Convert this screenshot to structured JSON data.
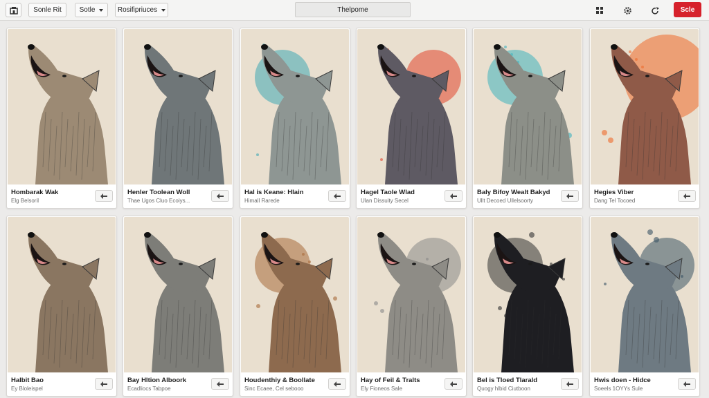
{
  "toolbar": {
    "home_icon": "home-icon",
    "title": "Sonle Rit",
    "sort_label": "Sotle",
    "filter_label": "Rosifipriuces",
    "search_placeholder": "Thelpome",
    "action_label": "Scle"
  },
  "cards": [
    {
      "title": "Hombarak Wak",
      "subtitle": "Elg Belsoril",
      "fur": "#9c8a74",
      "splash": ""
    },
    {
      "title": "Henler Toolean Woll",
      "subtitle": "Thae Ugos Cluo Ecoiys...",
      "fur": "#6f7678",
      "splash": ""
    },
    {
      "title": "Hal is Keane: Hlain",
      "subtitle": "Himall Rarede",
      "fur": "#8e9693",
      "splash": "#3fa7b4"
    },
    {
      "title": "Hagel Taole Wlad",
      "subtitle": "Ulan Dissuity Secel",
      "fur": "#5e5a63",
      "splash": "#e2462e"
    },
    {
      "title": "Baly Bifoy Wealt Bakyd",
      "subtitle": "Ullt Decoed Ullelsoorty",
      "fur": "#8c8f88",
      "splash": "#3fb3be"
    },
    {
      "title": "Hegies Viber",
      "subtitle": "Dang Tel Tocoed",
      "fur": "#8f5a48",
      "splash": "#ee6a2c"
    },
    {
      "title": "Halbit Bao",
      "subtitle": "Ey Bloleispel",
      "fur": "#8a7661",
      "splash": ""
    },
    {
      "title": "Bay Hltion Alboork",
      "subtitle": "Ecadliocs Tabpoe",
      "fur": "#7d7d78",
      "splash": ""
    },
    {
      "title": "Houdenthiy & Boollate",
      "subtitle": "Sinc Ecaee, Cel sebooo",
      "fur": "#8d6a4e",
      "splash": "#a86a3a"
    },
    {
      "title": "Hay of Feil & Tralts",
      "subtitle": "Ely Fioneos Sale",
      "fur": "#8e8c86",
      "splash": "#888888"
    },
    {
      "title": "Bel is Tloed Tlarald",
      "subtitle": "Quogy hlbid Ciutboon",
      "fur": "#1e1e22",
      "splash": "#333333"
    },
    {
      "title": "Hwis doen - Hidce",
      "subtitle": "Soeels 1OYYs Sule",
      "fur": "#6e7a82",
      "splash": "#3c5566"
    }
  ]
}
